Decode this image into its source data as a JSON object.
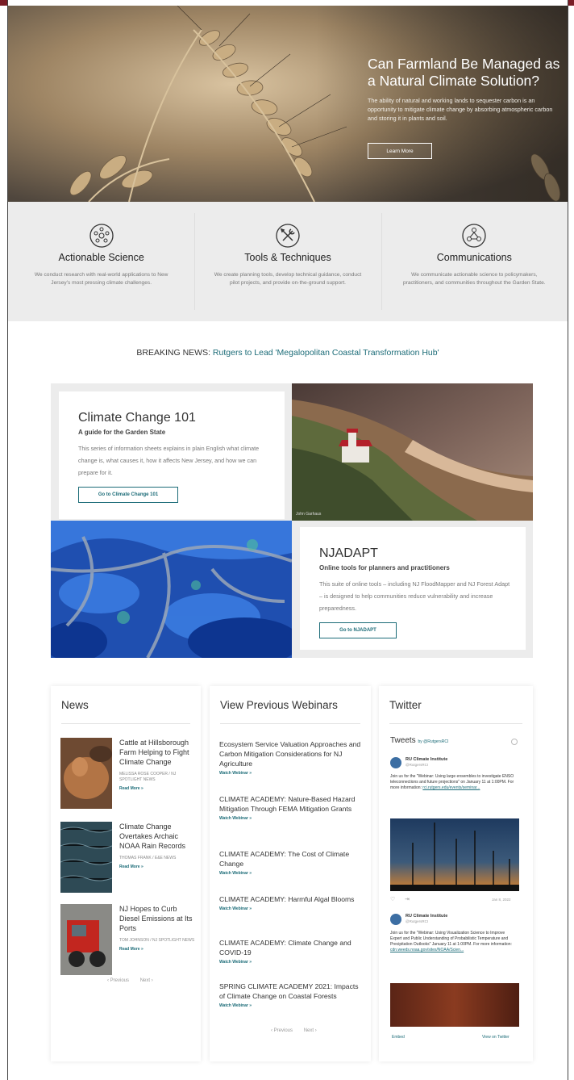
{
  "hero": {
    "title": "Can Farmland Be Managed as a Natural Climate Solution?",
    "text": "The ability of natural and working lands to sequester carbon is an opportunity to mitigate climate change by absorbing atmospheric carbon and storing it in plants and soil.",
    "button": "Learn More"
  },
  "features": [
    {
      "icon": "network-icon",
      "title": "Actionable Science",
      "text": "We conduct research with real-world applications to New Jersey's most pressing climate challenges."
    },
    {
      "icon": "tools-icon",
      "title": "Tools & Techniques",
      "text": "We create planning tools, develop technical guidance, conduct pilot projects, and provide on-the-ground support."
    },
    {
      "icon": "people-network-icon",
      "title": "Communications",
      "text": "We communicate actionable science to policymakers, practitioners, and communities throughout the Garden State."
    }
  ],
  "breaking": {
    "label": "BREAKING NEWS:",
    "link": "Rutgers to Lead 'Megalopolitan Coastal Transformation Hub'"
  },
  "cards": {
    "cc101": {
      "title": "Climate Change 101",
      "subtitle": "A guide for the Garden State",
      "text": "This series of information sheets explains in plain English what climate change is, what causes it, how it affects New Jersey, and how we can prepare for it.",
      "button": "Go to Climate Change 101"
    },
    "photo_credit": "John Garhaus",
    "njadapt": {
      "title": "NJADAPT",
      "subtitle": "Online tools for planners and practitioners",
      "text": "This suite of online tools – including NJ FloodMapper and NJ Forest Adapt – is designed to help communities reduce vulnerability and increase preparedness.",
      "button": "Go to NJADAPT"
    }
  },
  "news": {
    "heading": "News",
    "items": [
      {
        "title": "Cattle at Hillsborough Farm Helping to Fight Climate Change",
        "meta": "MELISSA ROSE COOPER / NJ SPOTLIGHT NEWS",
        "more": "Read More »"
      },
      {
        "title": "Climate Change Overtakes Archaic NOAA Rain Records",
        "meta": "THOMAS FRANK / E&E NEWS",
        "more": "Read More »"
      },
      {
        "title": "NJ Hopes to Curb Diesel Emissions at Its Ports",
        "meta": "TOM JOHNSON / NJ SPOTLIGHT NEWS",
        "more": "Read More »"
      }
    ],
    "prev": "‹ Previous",
    "next": "Next ›"
  },
  "webinars": {
    "heading": "View Previous Webinars",
    "items": [
      {
        "title": "Ecosystem Service Valuation Approaches and Carbon Mitigation Considerations for NJ Agriculture",
        "link": "Watch Webinar »"
      },
      {
        "title": "CLIMATE ACADEMY: Nature-Based Hazard Mitigation Through FEMA Mitigation Grants",
        "link": "Watch Webinar »"
      },
      {
        "title": "CLIMATE ACADEMY: The Cost of Climate Change",
        "link": "Watch Webinar »"
      },
      {
        "title": "CLIMATE ACADEMY: Harmful Algal Blooms",
        "link": "Watch Webinar »"
      },
      {
        "title": "CLIMATE ACADEMY: Climate Change and COVID-19",
        "link": "Watch Webinar »"
      },
      {
        "title": "SPRING CLIMATE ACADEMY 2021: Impacts of Climate Change on Coastal Forests",
        "link": "Watch Webinar »"
      }
    ],
    "prev": "‹ Previous",
    "next": "Next ›"
  },
  "twitter": {
    "heading": "Twitter",
    "tweets_label": "Tweets",
    "by": "by @RutgersRCI",
    "tweets": [
      {
        "name": "RU Climate Institute",
        "handle": "@RutgersRCI",
        "text": "Join us for the \"Webinar: Using large ensembles to investigate ENSO teleconnections and future projections\" on January 11 at 1:00PM. For more information:",
        "link": "rci.rutgers.edu/events/seminar..."
      },
      {
        "name": "RU Climate Institute",
        "handle": "@RutgersRCI",
        "text": "Join us for the \"Webinar: Using Visualization Science to Improve Expert and Public Understanding of Probabilistic Temperature and Precipitation Outlooks\" January 11 at 1:00PM. For more information:",
        "link": "cdn.weeds.noaa.gov/sites/NOAA/Scien..."
      }
    ],
    "date": "Jan 8, 2022",
    "embed": "Embed",
    "view": "View on Twitter"
  },
  "colors": {
    "accent": "#1c6c78",
    "topbar": "#7a1c25",
    "panel": "#ececec"
  }
}
